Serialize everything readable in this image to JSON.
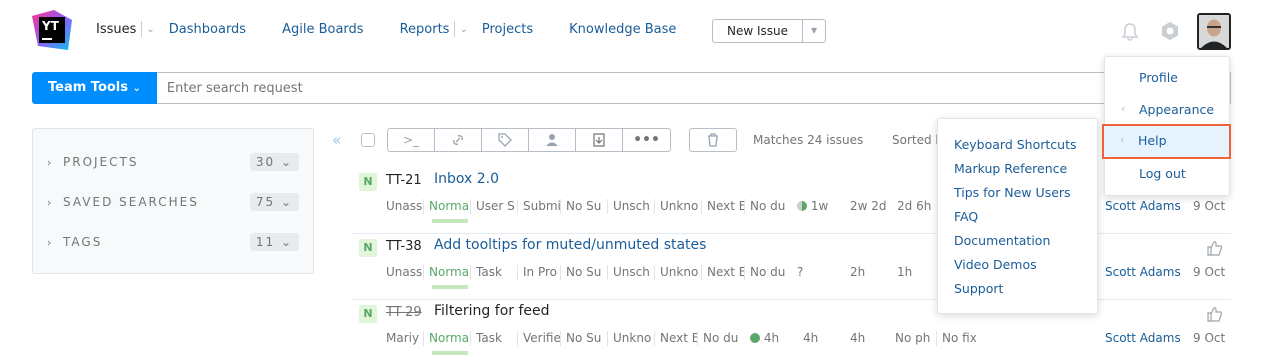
{
  "logo": {
    "text": "YT"
  },
  "nav": {
    "issues": "Issues",
    "dashboards": "Dashboards",
    "agile": "Agile Boards",
    "reports": "Reports",
    "projects": "Projects",
    "kb": "Knowledge Base",
    "new_issue": "New Issue"
  },
  "search": {
    "tag": "Team Tools",
    "placeholder": "Enter search request"
  },
  "sidebar": {
    "projects": {
      "label": "PROJECTS",
      "count": "30"
    },
    "saved": {
      "label": "SAVED SEARCHES",
      "count": "75"
    },
    "tags": {
      "label": "TAGS",
      "count": "11"
    }
  },
  "toolbar": {
    "matches": "Matches 24 issues",
    "sorted": "Sorted b"
  },
  "issues": [
    {
      "priority": "N",
      "id": "TT-21",
      "summary": "Inbox 2.0",
      "fields": [
        "Unass",
        "Norma",
        "User S",
        "Submi",
        "No Su",
        "Unsch",
        "Unkno",
        "Next E",
        "No du",
        "1w",
        "2w 2d",
        "2d 6h"
      ],
      "assignee": "Scott Adams",
      "date": "9 Oct"
    },
    {
      "priority": "N",
      "id": "TT-38",
      "summary": "Add tooltips for muted/unmuted states",
      "fields": [
        "Unass",
        "Norma",
        "Task",
        "In Pro",
        "No Su",
        "Unsch",
        "Unkno",
        "Next E",
        "No du",
        "?",
        "2h",
        "1h"
      ],
      "assignee": "Scott Adams",
      "date": "9 Oct"
    },
    {
      "priority": "N",
      "id": "TT-29",
      "summary": "Filtering for feed",
      "fields": [
        "Mariy",
        "Norma",
        "Task",
        "Verifie",
        "No Su",
        "Unkno",
        "Next E",
        "No du",
        "4h",
        "4h",
        "4h",
        "No ph",
        "No fix"
      ],
      "assignee": "Scott Adams",
      "date": "9 Oct"
    }
  ],
  "help_menu": [
    "Keyboard Shortcuts",
    "Markup Reference",
    "Tips for New Users",
    "FAQ",
    "Documentation",
    "Video Demos",
    "Support"
  ],
  "user_menu": {
    "profile": "Profile",
    "appearance": "Appearance",
    "help": "Help",
    "logout": "Log out"
  }
}
